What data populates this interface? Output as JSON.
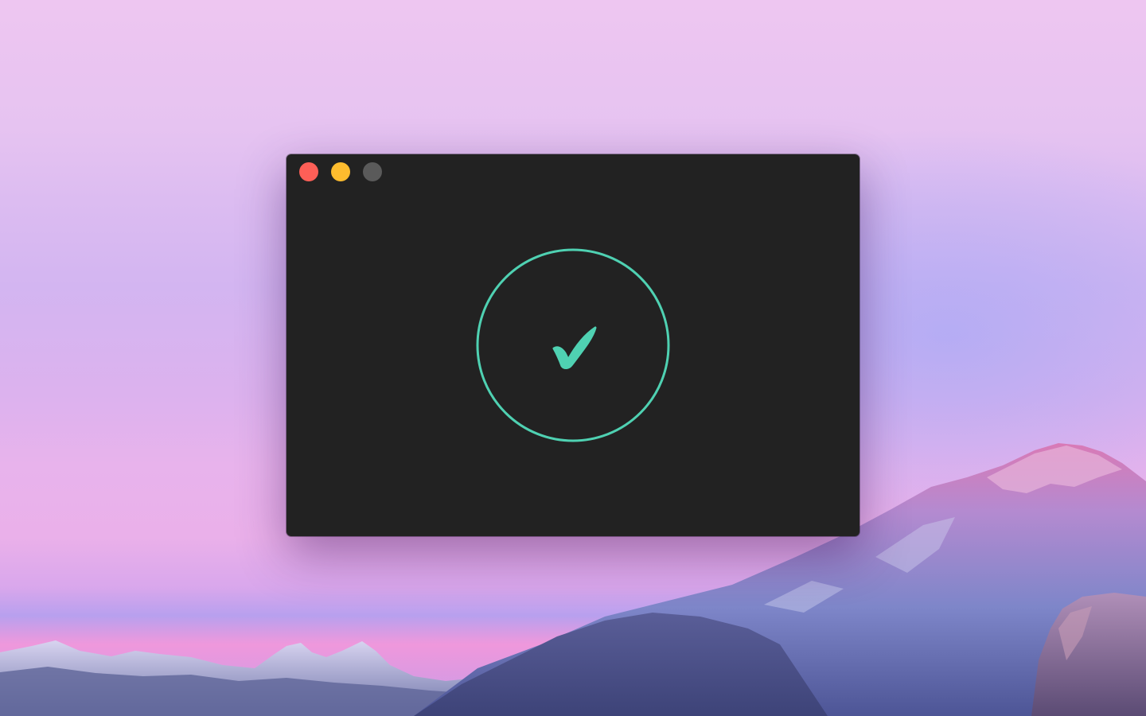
{
  "window": {
    "background": "#222222",
    "controls": {
      "close_color": "#fe5f57",
      "minimize_color": "#febc2e",
      "zoom_color": "#5a5a5a"
    }
  },
  "status": {
    "icon": "checkmark-icon",
    "accent": "#4fd1b2"
  }
}
